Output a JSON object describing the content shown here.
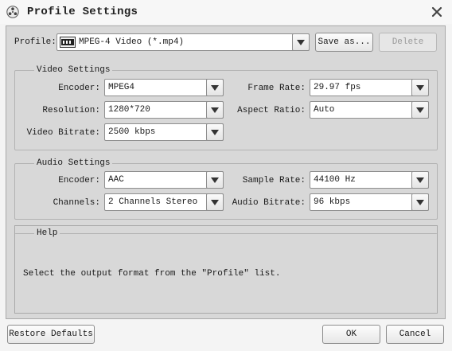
{
  "window": {
    "title": "Profile Settings",
    "app_icon": "film-reel-icon",
    "close_icon": "close-icon"
  },
  "profile": {
    "label": "Profile:",
    "value": "MPEG-4 Video (*.mp4)",
    "format_icon": "mpeg-icon",
    "save_as": "Save as...",
    "delete": "Delete"
  },
  "video": {
    "title": "Video Settings",
    "encoder_label": "Encoder:",
    "encoder": "MPEG4",
    "frame_rate_label": "Frame Rate:",
    "frame_rate": "29.97 fps",
    "resolution_label": "Resolution:",
    "resolution": "1280*720",
    "aspect_ratio_label": "Aspect Ratio:",
    "aspect_ratio": "Auto",
    "bitrate_label": "Video Bitrate:",
    "bitrate": "2500 kbps"
  },
  "audio": {
    "title": "Audio Settings",
    "encoder_label": "Encoder:",
    "encoder": "AAC",
    "sample_rate_label": "Sample Rate:",
    "sample_rate": "44100 Hz",
    "channels_label": "Channels:",
    "channels": "2 Channels Stereo",
    "bitrate_label": "Audio Bitrate:",
    "bitrate": "96 kbps"
  },
  "help": {
    "title": "Help",
    "text": "Select the output format from the \"Profile\" list."
  },
  "footer": {
    "restore": "Restore Defaults",
    "ok": "OK",
    "cancel": "Cancel"
  },
  "colors": {
    "client_bg": "#d8d8d8",
    "window_bg": "#f4f4f4",
    "disabled_text": "#9a9a9a"
  }
}
